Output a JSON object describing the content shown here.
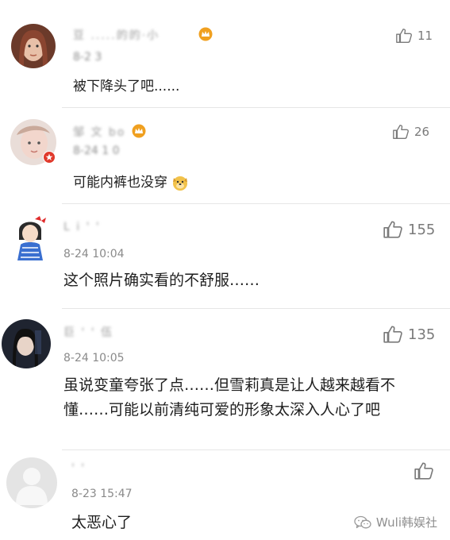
{
  "comments": [
    {
      "username": "豆 .....的的·小 ",
      "time": "8-2 3",
      "text": "被下降头了吧......",
      "likes": "11"
    },
    {
      "username": "邹 文 bo",
      "time": "8-24 1 0",
      "text": "可能内裤也没穿",
      "likes": "26"
    },
    {
      "username": "L i ' ' ",
      "time": "8-24 10:04",
      "text": "这个照片确实看的不舒服……",
      "likes": "155"
    },
    {
      "username": "巨 ' ' 伍",
      "time": "8-24 10:05",
      "text": "虽说变童夸张了点……但雪莉真是让人越来越看不懂……可能以前清纯可爱的形象太深入人心了吧",
      "likes": "135"
    },
    {
      "username": "' ' ",
      "time": "8-23 15:47",
      "text": "太恶心了",
      "likes": ""
    }
  ],
  "watermark": "Wuli韩娱社",
  "icons": {
    "like": "thumbs-up-icon",
    "vip": "crown-badge-icon",
    "emoji": "dog-face-emoji-icon",
    "watermark": "wechat-icon"
  },
  "colors": {
    "badge": "#f0a020",
    "badge_red": "#e0392b",
    "meta": "#8a8a8a"
  }
}
